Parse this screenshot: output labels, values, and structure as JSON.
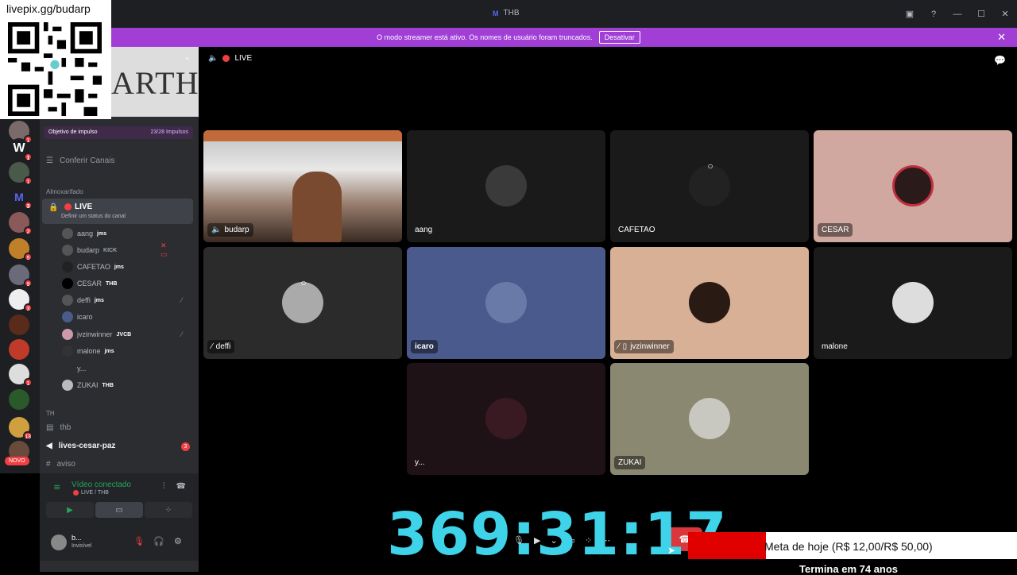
{
  "overlay": {
    "qr_url": "livepix.gg/budarp"
  },
  "titlebar": {
    "logo": "M",
    "title": "THB"
  },
  "banner": {
    "message": "O modo streamer está ativo. Os nomes de usuário foram truncados.",
    "button": "Desativar"
  },
  "server": {
    "banner_text": "ARTHB",
    "boost_label": "Objetivo de impulso",
    "boost_count": "23/28 Impulsos",
    "browse": "Conferir Canais",
    "category1": "Almoxarifado",
    "active_channel": "LIVE",
    "active_status": "Definir um status do canal",
    "category2": "TH"
  },
  "guild_badges": [
    "1",
    "1",
    "1",
    "3",
    "2",
    "5",
    "9",
    "3",
    "1",
    "13"
  ],
  "novo_label": "NOVO",
  "voice_users": [
    {
      "name": "aang",
      "tag": "jms"
    },
    {
      "name": "budarp",
      "tag": "KICK"
    },
    {
      "name": "CAFETAO",
      "tag": "jms"
    },
    {
      "name": "CESAR",
      "tag": "THB"
    },
    {
      "name": "deffi",
      "tag": "jms"
    },
    {
      "name": "icaro",
      "tag": ""
    },
    {
      "name": "jvzinwinner",
      "tag": "JVCB"
    },
    {
      "name": "malone",
      "tag": "jms"
    },
    {
      "name": "y...",
      "tag": ""
    },
    {
      "name": "ZUKAI",
      "tag": "THB"
    }
  ],
  "channels": [
    {
      "name": "thb"
    },
    {
      "name": "lives-cesar-paz",
      "badge": "3"
    },
    {
      "name": "aviso"
    }
  ],
  "voice_panel": {
    "title": "Vídeo conectado",
    "sub": "LIVE / THB"
  },
  "user_panel": {
    "name": "b...",
    "status": "Invisível"
  },
  "stage": {
    "live_label": "LIVE"
  },
  "tiles": [
    {
      "name": "budarp"
    },
    {
      "name": "aang"
    },
    {
      "name": "CAFETAO"
    },
    {
      "name": "CESAR"
    },
    {
      "name": "deffi"
    },
    {
      "name": "icaro"
    },
    {
      "name": "jvzinwinner"
    },
    {
      "name": "malone"
    },
    {
      "name": "y..."
    },
    {
      "name": "ZUKAI"
    }
  ],
  "timer": "369:31:17",
  "goal": {
    "text": "Meta de hoje (R$ 12,00/R$ 50,00)",
    "progress": 0.24,
    "sub": "Termina em 74 anos"
  },
  "colors": {
    "accent": "#a03ed6",
    "timer": "#3fd3ea",
    "danger": "#da373c",
    "online": "#23a55a"
  }
}
